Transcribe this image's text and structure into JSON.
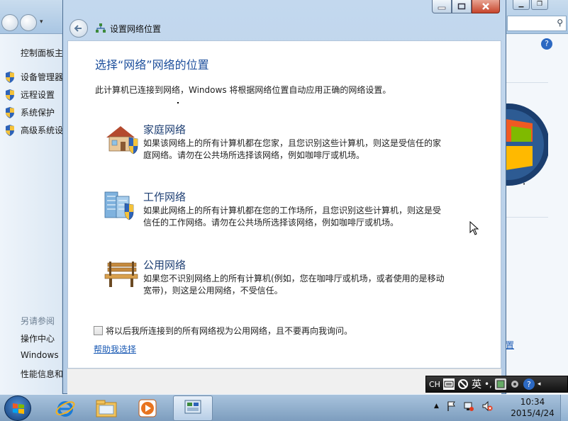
{
  "background_window": {
    "sidebar_links": [
      {
        "label": "控制面板主",
        "shield": false
      },
      {
        "label": "设备管理器",
        "shield": true
      },
      {
        "label": "远程设置",
        "shield": true
      },
      {
        "label": "系统保护",
        "shield": true
      },
      {
        "label": "高级系统设",
        "shield": true
      }
    ],
    "see_also_title": "另请参阅",
    "see_also_links": [
      "操作中心",
      "Windows",
      "性能信息和"
    ],
    "right_link": "置"
  },
  "dialog": {
    "title": "设置网络位置",
    "heading": "选择“网络”网络的位置",
    "intro": "此计算机已连接到网络，Windows 将根据网络位置自动应用正确的网络设置。",
    "options": [
      {
        "icon": "home-network-icon",
        "title": "家庭网络",
        "description": "如果该网络上的所有计算机都在您家，且您识别这些计算机，则这是受信任的家庭网络。请勿在公共场所选择该网络，例如咖啡厅或机场。"
      },
      {
        "icon": "work-network-icon",
        "title": "工作网络",
        "description": "如果此网络上的所有计算机都在您的工作场所，且您识别这些计算机，则这是受信任的工作网络。请勿在公共场所选择该网络，例如咖啡厅或机场。"
      },
      {
        "icon": "public-network-icon",
        "title": "公用网络",
        "description": "如果您不识别网络上的所有计算机(例如，您在咖啡厅或机场，或者使用的是移动宽带)，则这是公用网络，不受信任。"
      }
    ],
    "checkbox_label": "将以后我所连接到的所有网络视为公用网络，且不要再向我询问。",
    "checkbox_checked": false,
    "help_link": "帮助我选择"
  },
  "language_bar": {
    "lang_code": "CH",
    "ime_mode": "英",
    "punct": "•,",
    "help": "?"
  },
  "taskbar": {
    "time": "10:34",
    "date": "2015/4/24",
    "pinned": [
      "ie-icon",
      "explorer-icon",
      "media-player-icon",
      "network-settings-icon"
    ]
  },
  "colors": {
    "heading_blue": "#1d4f9c",
    "link_blue": "#1a5ab4",
    "close_red": "#c7452c"
  }
}
